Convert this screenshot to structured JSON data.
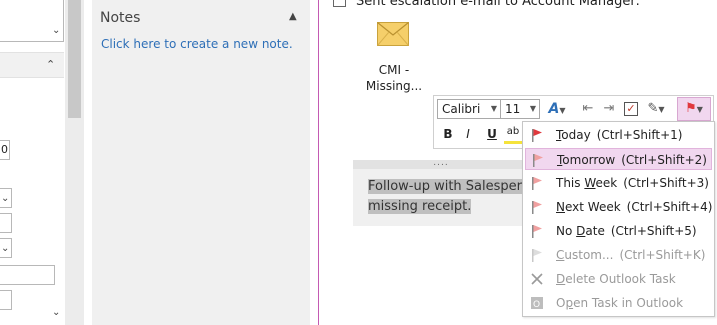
{
  "notes_pane": {
    "title": "Notes",
    "create_link": "Click here to create a new note."
  },
  "left_pane": {
    "field_value": "0"
  },
  "main": {
    "sent_line": "Sent escalation e-mail to Account Manager:",
    "attachment_line1": "CMI -",
    "attachment_line2": "Missing...",
    "note_line1": "Follow-up with Salesperso",
    "note_line2": "missing receipt.",
    "note_handle": "...."
  },
  "toolbar": {
    "font_name": "Calibri",
    "font_size": "11",
    "bold": "B",
    "italic": "I",
    "underline": "U",
    "highlight": "ab"
  },
  "flag_menu": {
    "items": [
      {
        "mnemonic": "T",
        "rest": "oday",
        "shortcut": "(Ctrl+Shift+1)",
        "icon": "red-flag-icon"
      },
      {
        "mnemonic": "T",
        "rest": "omorrow",
        "shortcut": "(Ctrl+Shift+2)",
        "icon": "flag-icon"
      },
      {
        "pre": "This ",
        "mnemonic": "W",
        "rest": "eek",
        "shortcut": "(Ctrl+Shift+3)",
        "icon": "flag-icon"
      },
      {
        "mnemonic": "N",
        "rest": "ext Week",
        "shortcut": "(Ctrl+Shift+4)",
        "icon": "flag-icon"
      },
      {
        "pre": "No ",
        "mnemonic": "D",
        "rest": "ate",
        "shortcut": "(Ctrl+Shift+5)",
        "icon": "flag-icon"
      },
      {
        "mnemonic": "C",
        "rest": "ustom...",
        "shortcut": "(Ctrl+Shift+K)",
        "icon": "flag-icon"
      },
      {
        "mnemonic": "D",
        "rest": "elete Outlook Task",
        "shortcut": "",
        "icon": "delete-x-icon"
      },
      {
        "pre": "O",
        "mnemonic": "p",
        "rest": "en Task in Outlook",
        "shortcut": "",
        "icon": "outlook-icon"
      }
    ]
  },
  "colors": {
    "accent_pink": "#c45ab3",
    "link_blue": "#2e6fb7",
    "flag_red": "#e0393e",
    "flag_light": "#f0a0a0"
  }
}
